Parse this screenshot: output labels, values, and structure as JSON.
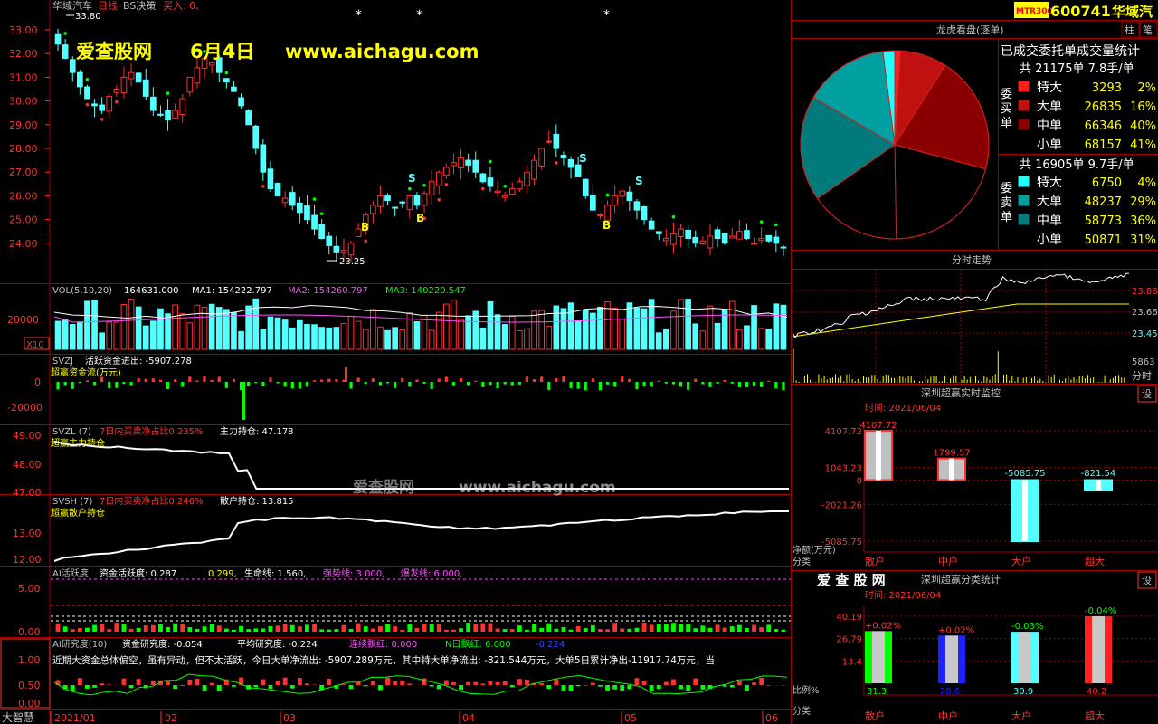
{
  "colors": {
    "up": "#ff3232",
    "down": "#54ffff",
    "grid": "#a00000",
    "bg": "#000000",
    "yellow": "#ffff00",
    "white": "#ffffff",
    "magenta": "#ff50ff",
    "green": "#00ff00"
  },
  "header": {
    "stock_name": "华域汽车",
    "period": "日线",
    "strategy": "BS决策",
    "buy_signal": "买入: 0,",
    "stars": [
      "*",
      "*",
      "*"
    ]
  },
  "watermark": {
    "site": "爱查股网",
    "date": "6月4日",
    "url": "www.aichagu.com",
    "center_url": "www.aichagu.com",
    "center_site": "爱查股网"
  },
  "main_chart": {
    "y_ticks": [
      "33.00",
      "32.00",
      "31.00",
      "30.00",
      "29.00",
      "28.00",
      "27.00",
      "26.00",
      "25.00",
      "24.00"
    ],
    "high_label": "33.80",
    "low_label": "23.25",
    "signals": [
      "B",
      "B",
      "B",
      "S",
      "S",
      "S"
    ]
  },
  "vol_panel": {
    "title": "VOL(5,10,20)",
    "value": "164631.000",
    "ma1": "MA1: 154222.797",
    "ma2": "MA2: 154260.797",
    "ma3": "MA3: 140220.547",
    "y_tick": "20000",
    "unit": "X10"
  },
  "svzj_panel": {
    "title": "SVZJ",
    "label": "活跃资金进出: -5907.278",
    "subtitle": "超赢资金流(万元)",
    "y_ticks": [
      "0",
      "-20000"
    ]
  },
  "svzl_panel": {
    "title": "SVZL (7)",
    "ratio": "7日内买卖净占比0.235%",
    "label": "主力持仓: 47.178",
    "subtitle": "超赢主力持仓",
    "y_ticks": [
      "49.00",
      "48.00",
      "47.00"
    ]
  },
  "svsh_panel": {
    "title": "SVSH (7)",
    "ratio": "7日内买卖净占比0.246%",
    "label": "散户持仓: 13.815",
    "subtitle": "超赢散户持仓",
    "y_ticks": [
      "13.00",
      "12.00"
    ]
  },
  "ai_active_panel": {
    "title": "AI活跃度",
    "v1": "资金活跃度: 0.287",
    "v2": "0.299,",
    "v3": "生命线: 1.560,",
    "v4": "强势线: 3.000,",
    "v5": "爆发线: 6.000,",
    "y_ticks": [
      "5.00",
      "0.00"
    ]
  },
  "ai_research_panel": {
    "title": "AI研究度(10)",
    "v1": "资金研究度: -0.054",
    "v2": "平均研究度: -0.224",
    "v3": "连续飘红: 0.000",
    "v4": "N日飘红: 6.000",
    "v5": "-0.224",
    "comment": "近期大资金总体偏空，虽有异动，但不太活跃，今日大单净流出: -5907.289万元，其中特大单净流出: -821.544万元，大单5日累计净出-11917.74万元，当",
    "y_ticks": [
      "1.00",
      "0.50",
      "0.00"
    ]
  },
  "x_axis": {
    "labels": [
      "2021/01",
      "02",
      "03",
      "04",
      "05",
      "06"
    ]
  },
  "bottom_left": "大智慧",
  "right_header": {
    "badge": "MTR300",
    "code": "600741",
    "name": "华域汽",
    "btn1": "柱",
    "btn2": "笔"
  },
  "dragon_panel": {
    "title": "龙虎看盘(逐单)",
    "subtitle": "已成交委托单成交量统计",
    "buy": {
      "side_label": "委买单",
      "total": "共 21175单 7.8手/单",
      "rows": [
        {
          "name": "特大",
          "vol": "3293",
          "pct": "2%",
          "color": "#ff2020"
        },
        {
          "name": "大单",
          "vol": "26835",
          "pct": "16%",
          "color": "#c01010"
        },
        {
          "name": "中单",
          "vol": "66346",
          "pct": "40%",
          "color": "#8a0000"
        },
        {
          "name": "小单",
          "vol": "68157",
          "pct": "41%",
          "color": "#000000"
        }
      ]
    },
    "sell": {
      "side_label": "委卖单",
      "total": "共 16905单 9.7手/单",
      "rows": [
        {
          "name": "特大",
          "vol": "6750",
          "pct": "4%",
          "color": "#20ffff"
        },
        {
          "name": "大单",
          "vol": "48237",
          "pct": "29%",
          "color": "#00a0a0"
        },
        {
          "name": "中单",
          "vol": "58773",
          "pct": "36%",
          "color": "#007a7a"
        },
        {
          "name": "小单",
          "vol": "50871",
          "pct": "31%",
          "color": "#000000"
        }
      ]
    }
  },
  "intraday": {
    "title": "分时走势",
    "ticks": [
      "23.86",
      "23.66",
      "23.45"
    ],
    "vol_tick": "5863",
    "label": "分时"
  },
  "monitor": {
    "title": "深圳超赢实时监控",
    "set_btn": "设",
    "time": "时间: 2021/06/04",
    "y_ticks": [
      "4107.72",
      "1043.23",
      "0",
      "-2021.26",
      "-5085.75"
    ],
    "axis_label1": "净额(万元)",
    "axis_label2": "分类",
    "categories": [
      "散户",
      "中户",
      "大户",
      "超大"
    ],
    "value_labels": [
      "4107.72",
      "1799.57",
      "-5085.75",
      "-821.54"
    ],
    "chart_data": {
      "type": "bar",
      "categories": [
        "散户",
        "中户",
        "大户",
        "超大"
      ],
      "values": [
        4107.72,
        1799.57,
        -5085.75,
        -821.54
      ],
      "ylabel": "净额(万元)",
      "xlabel": "分类",
      "ylim": [
        -5085.75,
        4107.72
      ]
    }
  },
  "class_stats": {
    "brand": "爱 查 股 网",
    "title": "深圳超赢分类统计",
    "set_btn": "设",
    "time": "时间: 2021/06/04",
    "y_ticks": [
      "40.19",
      "26.79",
      "13.4"
    ],
    "axis_label1": "比例%",
    "axis_label2": "分类",
    "categories": [
      "散户",
      "中户",
      "大户",
      "超大"
    ],
    "bottom_values": [
      "31.3",
      "28.6",
      "30.9",
      "40.2"
    ],
    "top_changes": [
      "+0.02%",
      "+0.02%",
      "-0.03%",
      "-0.04%"
    ],
    "chart_data": {
      "type": "bar",
      "categories": [
        "散户",
        "中户",
        "大户",
        "超大"
      ],
      "values": [
        31.3,
        28.6,
        30.9,
        40.2
      ],
      "ylabel": "比例%",
      "xlabel": "分类",
      "ylim": [
        0,
        40.19
      ]
    }
  }
}
